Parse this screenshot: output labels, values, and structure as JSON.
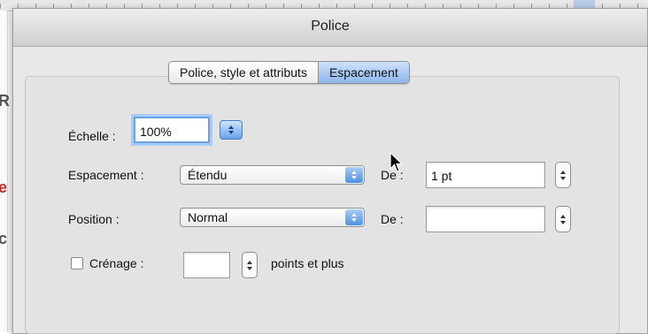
{
  "window": {
    "title": "Police"
  },
  "tabs": [
    {
      "label": "Police, style et attributs",
      "selected": false
    },
    {
      "label": "Espacement",
      "selected": true
    }
  ],
  "scale": {
    "label": "Échelle :",
    "value": "100%"
  },
  "spacing": {
    "label": "Espacement :",
    "selected": "Étendu",
    "amount_label": "De :",
    "amount_value": "1 pt"
  },
  "position": {
    "label": "Position :",
    "selected": "Normal",
    "amount_label": "De :",
    "amount_value": ""
  },
  "kerning": {
    "label": "Crénage :",
    "checked": false,
    "value": "",
    "suffix": "points et plus"
  },
  "colors": {
    "accent": "#6aa2e8",
    "selected_tab": "#8db6ec",
    "dialog_bg": "#e3e3e3"
  },
  "icons": [
    "cursor-icon",
    "stepper-icon",
    "popup-arrows-icon",
    "checkbox-icon"
  ]
}
